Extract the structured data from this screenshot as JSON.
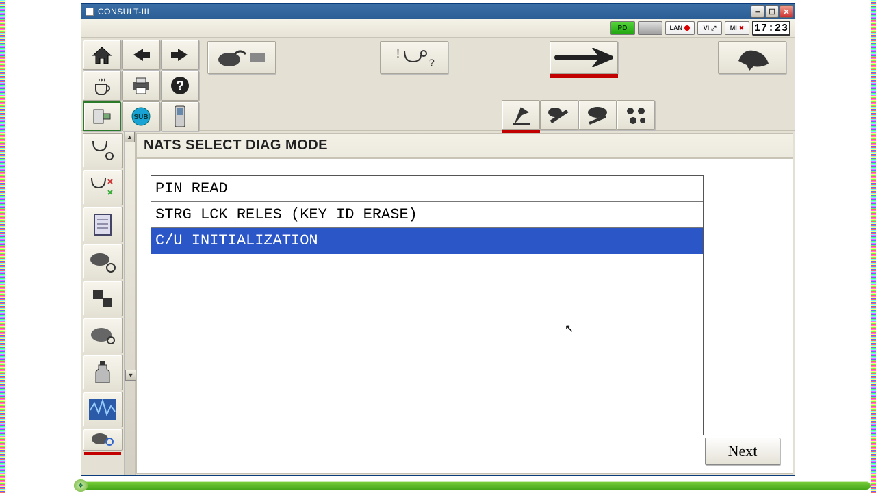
{
  "window": {
    "title": "CONSULT-III"
  },
  "status": {
    "pd_label": "PD",
    "lan_label": "LAN",
    "vi_label": "VI",
    "mi_label": "MI",
    "clock": "17:23"
  },
  "toolbar": {
    "home": "home-icon",
    "back": "back-icon",
    "forward": "forward-icon",
    "coffee": "coffee-icon",
    "print": "print-icon",
    "help": "help-icon",
    "connect": "connect-icon",
    "sub": "SUB",
    "phone": "phone-icon",
    "big1": "vehicle-connector-icon",
    "big2": "stethoscope-icon",
    "big3": "wrench-icon",
    "big4": "bird-icon",
    "mid1": "flag-tool-icon",
    "mid2": "plug-wrench-icon",
    "mid3": "cloud-wrench-icon",
    "mid4": "group-icon"
  },
  "sidebar": {
    "items": [
      "steth-dual-icon",
      "steth-spark-icon",
      "document-icon",
      "cloud-link-icon",
      "shapes-icon",
      "folder-icon",
      "bottle-icon",
      "waveform-icon",
      "cloud-search-icon"
    ]
  },
  "panel": {
    "title": "NATS SELECT DIAG MODE",
    "options": [
      {
        "label": "PIN READ",
        "selected": false
      },
      {
        "label": "STRG LCK RELES (KEY ID ERASE)",
        "selected": false
      },
      {
        "label": "C/U INITIALIZATION",
        "selected": true
      }
    ],
    "next": "Next"
  }
}
